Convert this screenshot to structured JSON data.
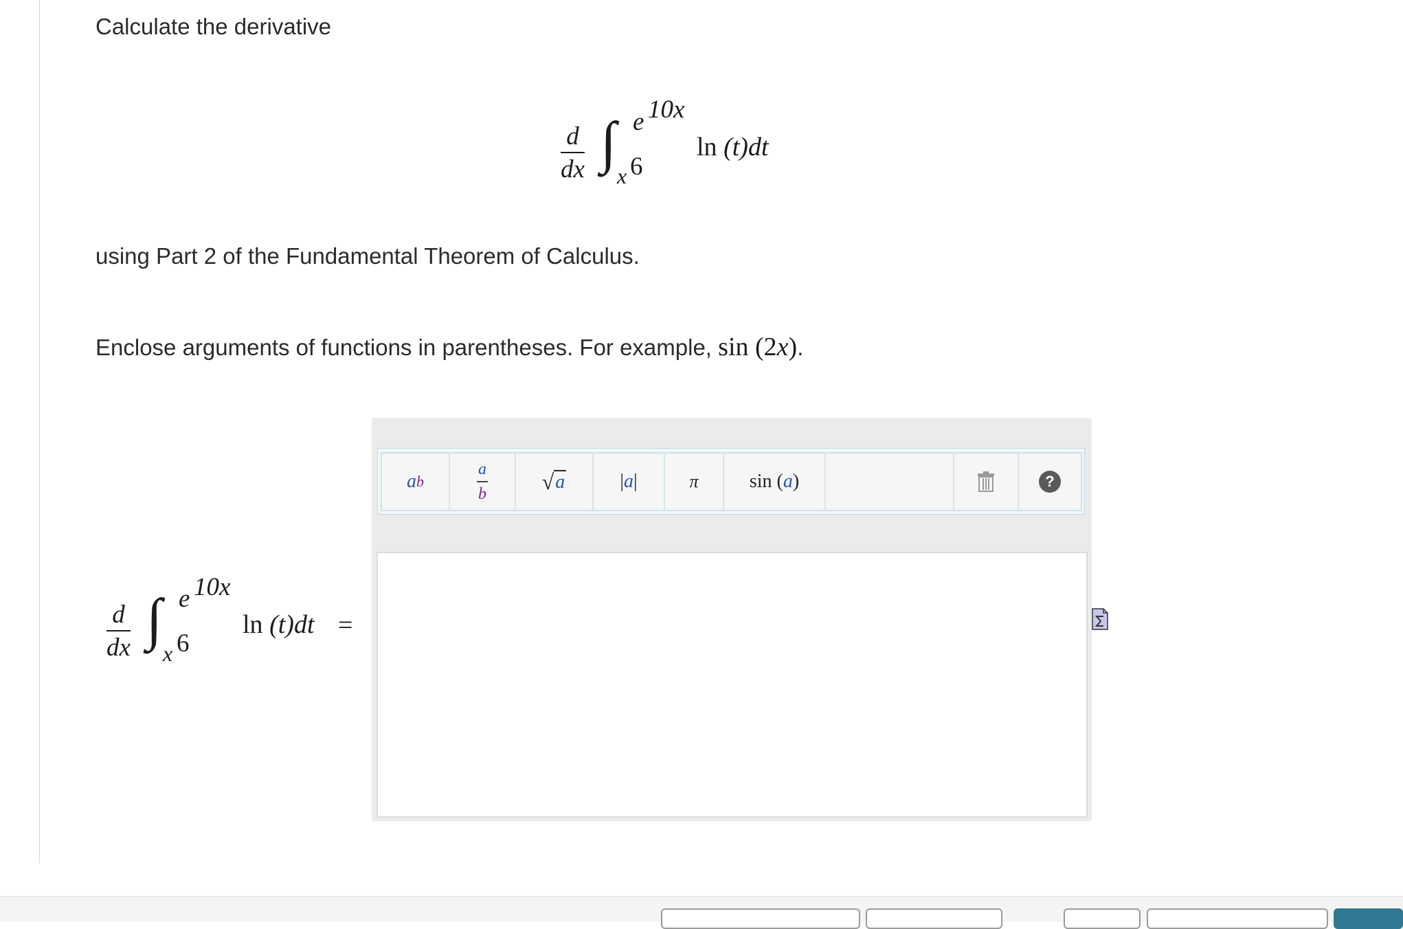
{
  "content": {
    "prompt": "Calculate the derivative",
    "theorem_text": "using Part 2 of the Fundamental Theorem of Calculus.",
    "instruction_prefix": "Enclose arguments of functions in parentheses. For example,",
    "example_fn": "sin",
    "example_paren_open": "(",
    "example_coef": "2",
    "example_var": "x",
    "example_paren_close": ")",
    "example_period": "."
  },
  "formula": {
    "d": "d",
    "dx": "dx",
    "integral": "∫",
    "upper_base": "e",
    "upper_exp": "10x",
    "lower_base": "x",
    "lower_exp": "6",
    "integrand_fn": "ln",
    "integrand_arg": "(t)",
    "integrand_d": "dt",
    "equals": "="
  },
  "toolbar": {
    "power_base": "a",
    "power_exp": "b",
    "frac_num": "a",
    "frac_den": "b",
    "sqrt_sym": "√",
    "sqrt_var": "a",
    "abs_bar": "|",
    "abs_var": "a",
    "pi": "π",
    "sin_fn": "sin",
    "sin_paren_open": "(",
    "sin_var": "a",
    "sin_paren_close": ")",
    "help": "?"
  },
  "colors": {
    "toolbar_variable": "#2255bb",
    "toolbar_exponent": "#7a2a8a",
    "primary_button": "#2f7a92",
    "panel_background": "#ebebeb"
  }
}
